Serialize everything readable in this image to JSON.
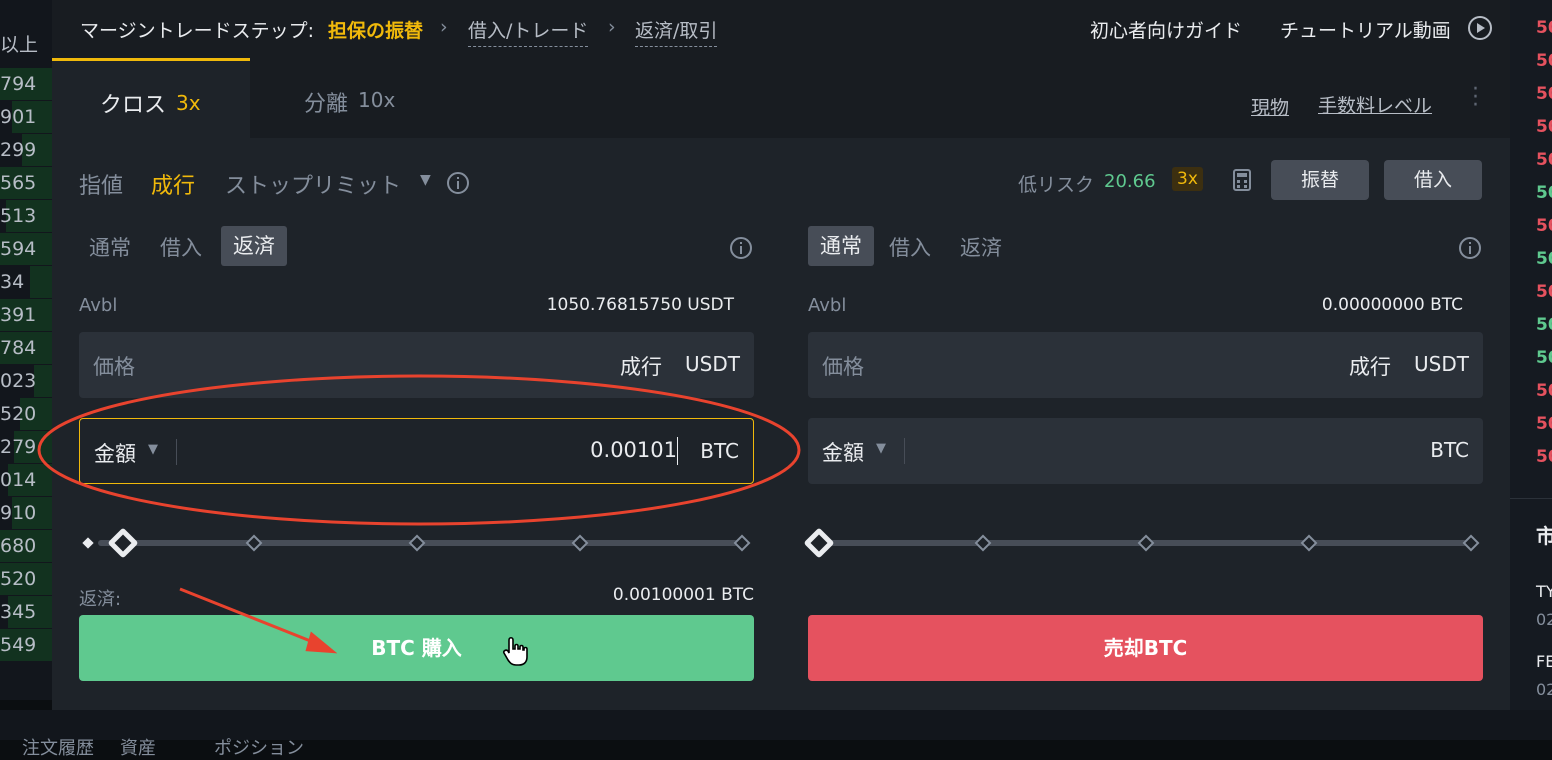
{
  "left_orderbook": {
    "header": "以上",
    "rows": [
      "794",
      "901",
      "299",
      "565",
      "513",
      "594",
      "34",
      "391",
      "784",
      "023",
      "520",
      "279",
      "014",
      "910",
      "680",
      "520",
      "345",
      "549"
    ]
  },
  "right_orderbook": {
    "rows": [
      "50",
      "50",
      "50",
      "50",
      "50",
      "50",
      "50",
      "50",
      "50",
      "50",
      "50",
      "50",
      "50",
      "50"
    ],
    "labels": [
      "市",
      "TY",
      "02",
      "FE",
      "02"
    ]
  },
  "breadcrumb": {
    "label": "マージントレードステップ:",
    "step1": "担保の振替",
    "step2": "借入/トレード",
    "step3": "返済/取引"
  },
  "header_links": {
    "guide": "初心者向けガイド",
    "tutorial": "チュートリアル動画"
  },
  "mode_tabs": {
    "cross": "クロス",
    "cross_lev": "3x",
    "isolated": "分離",
    "isolated_lev": "10x"
  },
  "right_links": {
    "spot": "現物",
    "fee": "手数料レベル"
  },
  "order_types": {
    "limit": "指値",
    "market": "成行",
    "stop": "ストップリミット"
  },
  "risk": {
    "label": "低リスク",
    "value": "20.66",
    "lev": "3x"
  },
  "actions": {
    "transfer": "振替",
    "borrow": "借入"
  },
  "buy": {
    "modes": [
      "通常",
      "借入",
      "返済"
    ],
    "avbl_label": "Avbl",
    "avbl_value": "1050.76815750 USDT",
    "price_placeholder": "価格",
    "price_market": "成行",
    "price_unit": "USDT",
    "amount_label": "金額",
    "amount_value": "0.00101",
    "amount_unit": "BTC",
    "repay_label": "返済:",
    "repay_value": "0.00100001 BTC",
    "button": "BTC 購入"
  },
  "sell": {
    "modes": [
      "通常",
      "借入",
      "返済"
    ],
    "avbl_label": "Avbl",
    "avbl_value": "0.00000000 BTC",
    "price_placeholder": "価格",
    "price_market": "成行",
    "price_unit": "USDT",
    "amount_label": "金額",
    "amount_unit": "BTC",
    "button": "売却BTC"
  },
  "colors": {
    "accent": "#f0b90b",
    "buy": "#5fc98f",
    "sell": "#e5525f",
    "annotation": "#e8432e"
  },
  "bottom_tabs": [
    "注文履歴",
    "資産",
    "ポジション"
  ]
}
